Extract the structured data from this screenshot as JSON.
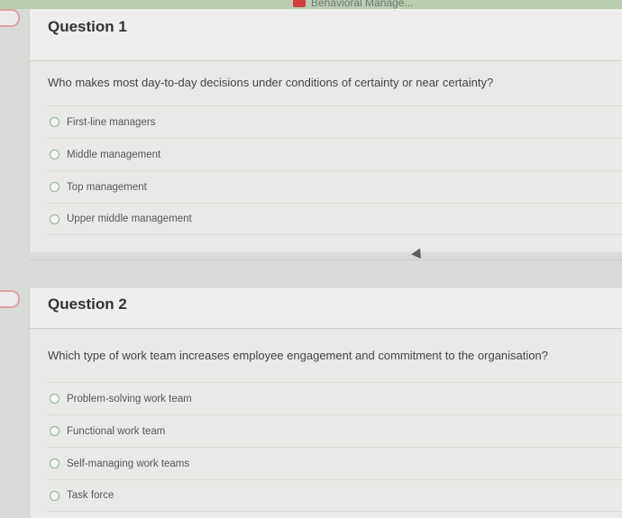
{
  "header": {
    "course_title": "Behavioral Manage..."
  },
  "questions": [
    {
      "title": "Question 1",
      "text": "Who makes most day-to-day decisions under conditions of certainty or near certainty?",
      "options": [
        "First-line managers",
        "Middle management",
        "Top management",
        "Upper middle management"
      ]
    },
    {
      "title": "Question 2",
      "text": "Which type of work team increases employee engagement and commitment to the organisation?",
      "options": [
        "Problem-solving work team",
        "Functional work team",
        "Self-managing work teams",
        "Task force"
      ]
    }
  ]
}
